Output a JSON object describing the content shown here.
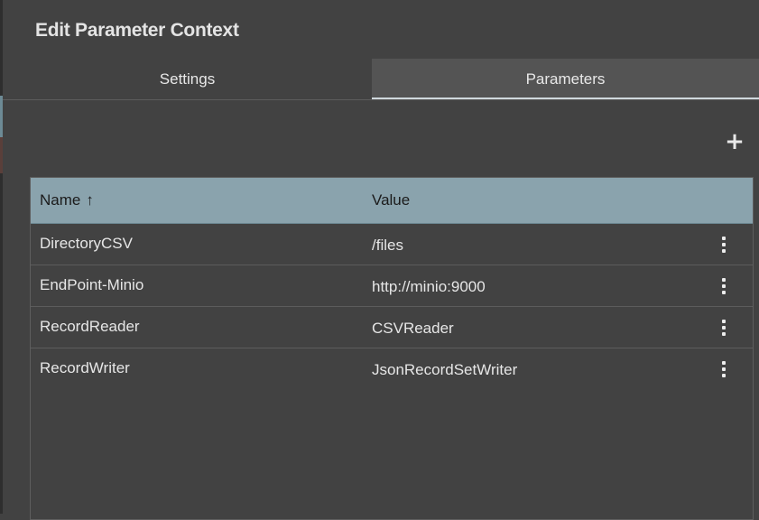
{
  "dialog": {
    "title": "Edit Parameter Context"
  },
  "tabs": [
    {
      "label": "Settings",
      "active": false
    },
    {
      "label": "Parameters",
      "active": true
    }
  ],
  "toolbar": {
    "add_icon": "plus-icon",
    "add_glyph": "+"
  },
  "table": {
    "columns": [
      {
        "label": "Name",
        "sort": "ascending"
      },
      {
        "label": "Value"
      }
    ],
    "sort_glyph": "↑",
    "rows": [
      {
        "name": "DirectoryCSV",
        "value": "/files"
      },
      {
        "name": "EndPoint-Minio",
        "value": "http://minio:9000"
      },
      {
        "name": "RecordReader",
        "value": "CSVReader"
      },
      {
        "name": "RecordWriter",
        "value": "JsonRecordSetWriter"
      }
    ]
  },
  "colors": {
    "background": "#424242",
    "header": "#8aa3ad",
    "active_tab": "#545454"
  }
}
